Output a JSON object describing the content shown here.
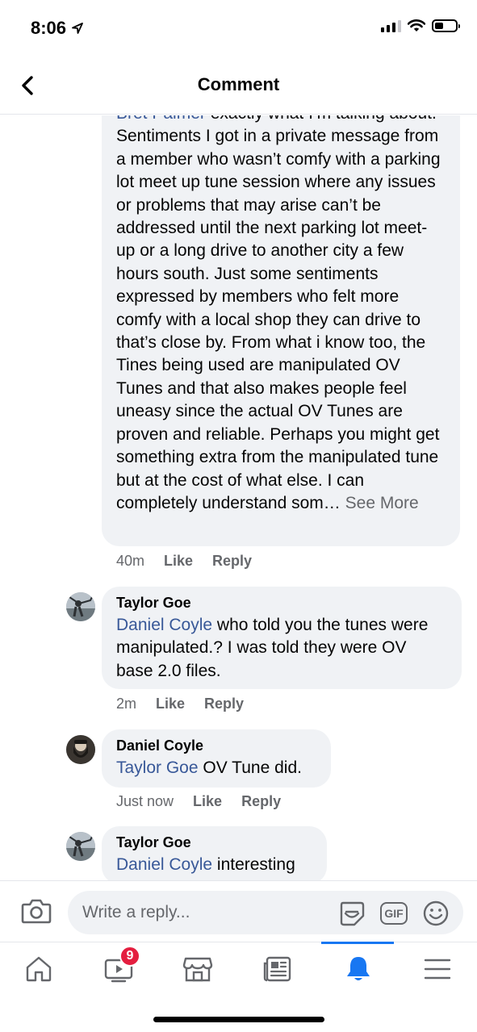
{
  "status_bar": {
    "time": "8:06",
    "icons": [
      "location-arrow-icon",
      "signal-icon",
      "wifi-icon",
      "battery-icon"
    ],
    "battery_level": 0.4
  },
  "header": {
    "title": "Comment",
    "back_icon": "chevron-left-icon"
  },
  "comments": [
    {
      "mention": "Bret Palmer",
      "text": " exactly what I’m talking about.  Sentiments I got in a private message from a member who wasn’t comfy with a parking lot meet up tune session where any issues or problems that may arise can’t be addressed until the next parking lot meet-up or a long drive to another city a few hours south.  Just some sentiments expressed by members who felt more comfy with a local shop they can drive to that’s close by.  From what i know too, the Tines being used are manipulated OV Tunes and that also makes people feel uneasy since the actual OV Tunes are proven and reliable.  Perhaps you might get something extra from the manipulated tune but at the cost of what else.  I can completely understand som… ",
      "see_more": "See More",
      "time": "40m",
      "like": "Like",
      "reply": "Reply"
    },
    {
      "author": "Taylor Goe",
      "mention": "Daniel Coyle",
      "text": " who told you the tunes were manipulated.? I was told they were OV base 2.0 files.",
      "time": "2m",
      "like": "Like",
      "reply": "Reply"
    },
    {
      "author": "Daniel Coyle",
      "mention": "Taylor Goe",
      "text": " OV Tune did.",
      "time": "Just now",
      "like": "Like",
      "reply": "Reply"
    },
    {
      "author": "Taylor Goe",
      "mention": "Daniel Coyle",
      "text": " interesting"
    }
  ],
  "composer": {
    "placeholder": "Write a reply...",
    "icons": [
      "camera-icon",
      "sticker-icon",
      "gif-icon",
      "emoji-icon"
    ],
    "gif_label": "GIF"
  },
  "bottom_nav": {
    "items": [
      "home-icon",
      "watch-icon",
      "marketplace-icon",
      "news-icon",
      "notifications-icon",
      "menu-icon"
    ],
    "watch_badge": "9",
    "active": "notifications-icon"
  },
  "colors": {
    "accent": "#1877f2",
    "mention": "#385898",
    "bubble": "#f0f2f5",
    "secondary_text": "#65676b",
    "badge": "#e41e3f"
  }
}
